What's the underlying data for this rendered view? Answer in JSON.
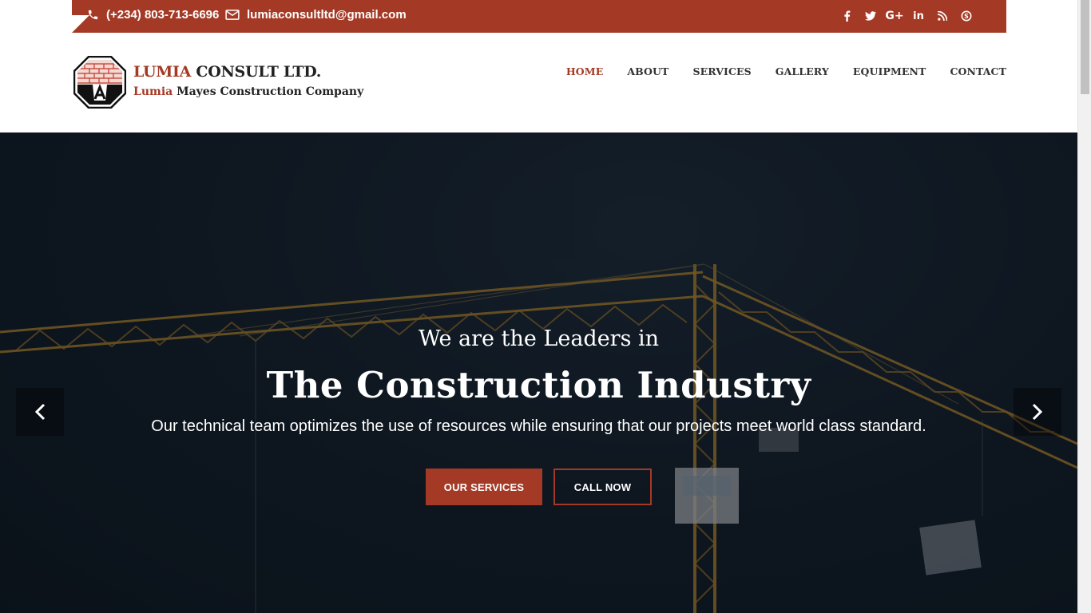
{
  "topbar": {
    "phone": "(+234) 803-713-6696",
    "email": "lumiaconsultltd@gmail.com",
    "social": [
      {
        "icon": "facebook-icon",
        "glyph": "f"
      },
      {
        "icon": "twitter-icon",
        "glyph": "t"
      },
      {
        "icon": "google-plus-icon",
        "glyph": "G+"
      },
      {
        "icon": "linkedin-icon",
        "glyph": "in"
      },
      {
        "icon": "rss-icon",
        "glyph": "rss"
      },
      {
        "icon": "skype-icon",
        "glyph": "S"
      }
    ]
  },
  "brand": {
    "title_accent": "LUMIA",
    "title_rest": " CONSULT LTD.",
    "sub_accent": "Lumia",
    "sub_rest": " Mayes Construction Company"
  },
  "nav": {
    "items": [
      {
        "label": "HOME",
        "active": true
      },
      {
        "label": "ABOUT",
        "active": false
      },
      {
        "label": "SERVICES",
        "active": false
      },
      {
        "label": "GALLERY",
        "active": false
      },
      {
        "label": "EQUIPMENT",
        "active": false
      },
      {
        "label": "CONTACT",
        "active": false
      }
    ]
  },
  "hero": {
    "kicker": "We are the Leaders in",
    "title": "The Construction Industry",
    "description": "Our technical team optimizes the use of resources while ensuring that our projects meet world class standard.",
    "primary_button": "OUR SERVICES",
    "secondary_button": "CALL NOW"
  },
  "colors": {
    "accent": "#a43a26",
    "hero_dark": "#121c25"
  }
}
